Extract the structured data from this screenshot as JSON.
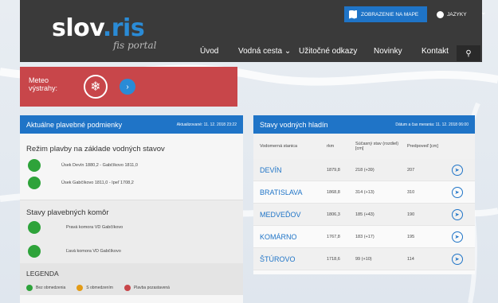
{
  "header": {
    "logo_part1": "slov",
    "logo_dot": ".",
    "logo_part2": "ris",
    "tagline": "fis portal",
    "map_button": "ZOBRAZENIE NA MAPE",
    "lang_button": "JAZYKY"
  },
  "nav": {
    "items": [
      "Úvod",
      "Vodná cesta",
      "Užitočné odkazy",
      "Novinky",
      "Kontakt"
    ]
  },
  "meteo": {
    "label": "Meteo výstrahy:"
  },
  "conditions": {
    "title": "Aktuálne plavebné podmienky",
    "updated": "Aktualizované: 11. 12. 2018 23:22",
    "section1_title": "Režim plavby na základe vodných stavov",
    "section1_rows": [
      {
        "text": "Úsek Devín 1880,2 - Gabčíkovo 1811,0",
        "color": "#2ea33a"
      },
      {
        "text": "Úsek Gabčíkovo 1811,0 - Ipeľ 1708,2",
        "color": "#2ea33a"
      }
    ],
    "section2_title": "Stavy plavebných komôr",
    "section2_rows": [
      {
        "text": "Pravá komora VD Gabčíkovo",
        "color": "#2ea33a"
      },
      {
        "text": "Ľavá komora VD Gabčíkovo",
        "color": "#2ea33a"
      }
    ],
    "legend_title": "LEGENDA",
    "legend_items": [
      {
        "label": "Bez obmedzenia",
        "color": "#2ea33a"
      },
      {
        "label": "S obmedzením",
        "color": "#e39b16"
      },
      {
        "label": "Plavba pozastavená",
        "color": "#c8464a"
      }
    ]
  },
  "stations": {
    "title": "Stavy vodných hladín",
    "updated": "Dátum a čas merania: 11. 12. 2018 06:00",
    "columns": [
      "Vodomerná stanica",
      "rkm",
      "Súčasný stav (rozdiel) [cm]",
      "Predpoveď [cm]"
    ],
    "rows": [
      {
        "name": "DEVÍN",
        "rkm": "1879,8",
        "state": "218 (+39)",
        "forecast": "207"
      },
      {
        "name": "BRATISLAVA",
        "rkm": "1868,8",
        "state": "314 (+13)",
        "forecast": "310"
      },
      {
        "name": "MEDVEĎOV",
        "rkm": "1806,3",
        "state": "185 (+43)",
        "forecast": "190"
      },
      {
        "name": "KOMÁRNO",
        "rkm": "1767,8",
        "state": "183 (+17)",
        "forecast": "195"
      },
      {
        "name": "ŠTÚROVO",
        "rkm": "1718,6",
        "state": "99 (+10)",
        "forecast": "114"
      }
    ]
  },
  "colors": {
    "accent": "#1f74c7",
    "header_bg": "#3a3a3a",
    "meteo_bg": "#c8464a",
    "ok": "#2ea33a"
  }
}
